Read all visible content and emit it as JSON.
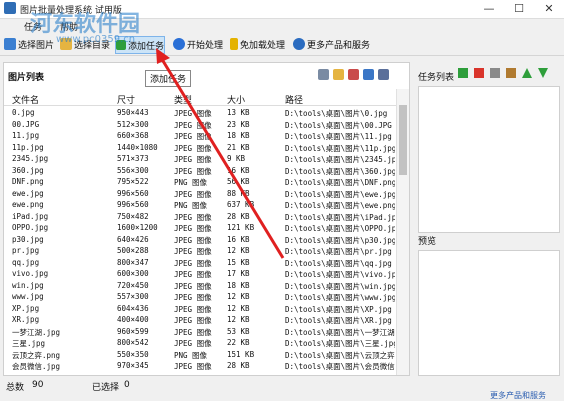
{
  "window": {
    "title": "图片批量处理系统 试用版",
    "controls": {
      "minimize": "—",
      "maximize": "☐",
      "close": "✕"
    }
  },
  "menu": [
    "任务",
    "帮助"
  ],
  "toolbar": [
    {
      "label": "选择图片",
      "icon": "images-icon",
      "color": "#3b7fd1"
    },
    {
      "label": "选择目录",
      "icon": "folder-icon",
      "color": "#e5b441"
    },
    {
      "label": "添加任务",
      "icon": "add-icon",
      "color": "#2e9e3b"
    },
    {
      "label": "开始处理",
      "icon": "play-icon",
      "color": "#2a6fd6"
    },
    {
      "label": "免加载处理",
      "icon": "lightning-icon",
      "color": "#e4b200"
    },
    {
      "label": "更多产品和服务",
      "icon": "apps-icon",
      "color": "#2b6cc0"
    }
  ],
  "tooltip": "添加任务",
  "watermark": {
    "main": "河东软件园",
    "url": "www.pc0359.cn"
  },
  "image_list": {
    "title": "图片列表",
    "columns": [
      "文件名",
      "尺寸",
      "类型",
      "大小",
      "路径"
    ],
    "rows": [
      [
        "0.jpg",
        "950×443",
        "JPEG 图像",
        "13 KB",
        "D:\\tools\\桌面\\图片\\0.jpg"
      ],
      [
        "00.JPG",
        "512×300",
        "JPEG 图像",
        "23 KB",
        "D:\\tools\\桌面\\图片\\00.JPG"
      ],
      [
        "11.jpg",
        "660×368",
        "JPEG 图像",
        "18 KB",
        "D:\\tools\\桌面\\图片\\11.jpg"
      ],
      [
        "11p.jpg",
        "1440×1080",
        "JPEG 图像",
        "21 KB",
        "D:\\tools\\桌面\\图片\\11p.jpg"
      ],
      [
        "2345.jpg",
        "571×373",
        "JPEG 图像",
        "9 KB",
        "D:\\tools\\桌面\\图片\\2345.jpg"
      ],
      [
        "360.jpg",
        "556×300",
        "JPEG 图像",
        "16 KB",
        "D:\\tools\\桌面\\图片\\360.jpg"
      ],
      [
        "DNF.png",
        "795×522",
        "PNG 图像",
        "56 KB",
        "D:\\tools\\桌面\\图片\\DNF.png"
      ],
      [
        "ewe.jpg",
        "996×560",
        "JPEG 图像",
        "88 KB",
        "D:\\tools\\桌面\\图片\\ewe.jpg"
      ],
      [
        "ewe.png",
        "996×560",
        "PNG 图像",
        "637 KB",
        "D:\\tools\\桌面\\图片\\ewe.png"
      ],
      [
        "iPad.jpg",
        "750×482",
        "JPEG 图像",
        "28 KB",
        "D:\\tools\\桌面\\图片\\iPad.jpg"
      ],
      [
        "OPPO.jpg",
        "1600×1200",
        "JPEG 图像",
        "121 KB",
        "D:\\tools\\桌面\\图片\\OPPO.jpg"
      ],
      [
        "p30.jpg",
        "640×426",
        "JPEG 图像",
        "16 KB",
        "D:\\tools\\桌面\\图片\\p30.jpg"
      ],
      [
        "pr.jpg",
        "500×288",
        "JPEG 图像",
        "12 KB",
        "D:\\tools\\桌面\\图片\\pr.jpg"
      ],
      [
        "qq.jpg",
        "800×347",
        "JPEG 图像",
        "15 KB",
        "D:\\tools\\桌面\\图片\\qq.jpg"
      ],
      [
        "vivo.jpg",
        "600×300",
        "JPEG 图像",
        "17 KB",
        "D:\\tools\\桌面\\图片\\vivo.jpg"
      ],
      [
        "win.jpg",
        "720×450",
        "JPEG 图像",
        "18 KB",
        "D:\\tools\\桌面\\图片\\win.jpg"
      ],
      [
        "www.jpg",
        "557×300",
        "JPEG 图像",
        "12 KB",
        "D:\\tools\\桌面\\图片\\www.jpg"
      ],
      [
        "XP.jpg",
        "604×436",
        "JPEG 图像",
        "12 KB",
        "D:\\tools\\桌面\\图片\\XP.jpg"
      ],
      [
        "XR.jpg",
        "400×400",
        "JPEG 图像",
        "12 KB",
        "D:\\tools\\桌面\\图片\\XR.jpg"
      ],
      [
        "一梦江湖.jpg",
        "960×599",
        "JPEG 图像",
        "53 KB",
        "D:\\tools\\桌面\\图片\\一梦江湖"
      ],
      [
        "三星.jpg",
        "800×542",
        "JPEG 图像",
        "22 KB",
        "D:\\tools\\桌面\\图片\\三星.jpg"
      ],
      [
        "云顶之弈.png",
        "550×350",
        "PNG 图像",
        "151 KB",
        "D:\\tools\\桌面\\图片\\云顶之弈"
      ],
      [
        "会员微信.jpg",
        "970×345",
        "JPEG 图像",
        "28 KB",
        "D:\\tools\\桌面\\图片\\会员微信"
      ]
    ]
  },
  "right_panel": {
    "tasks_label": "任务列表",
    "preview_label": "预览",
    "icon_colors": {
      "add": "#2e9e3b",
      "delete": "#d9342b",
      "tool": "#8a8a8a",
      "brush": "#b07a30",
      "up": "#2e9e3b",
      "down": "#2e9e3b"
    }
  },
  "status": {
    "total_label": "总数",
    "total_value": "90",
    "selected_label": "已选择",
    "selected_value": "0",
    "link": "更多产品和服务"
  },
  "annotation_color": "#e02020"
}
